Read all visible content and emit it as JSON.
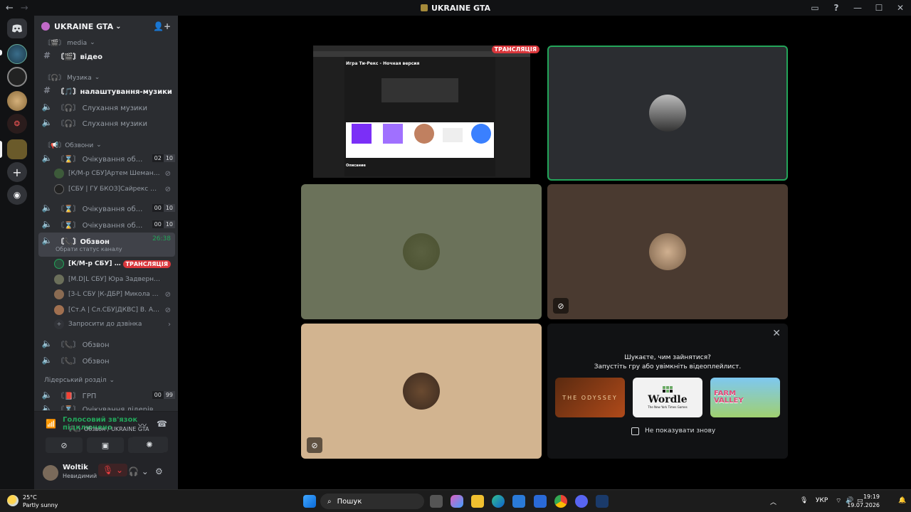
{
  "window": {
    "title": "UKRAINE GTA",
    "back": "←",
    "forward": "→",
    "inbox_icon": "inbox-icon",
    "help": "?",
    "minimize": "—",
    "maximize": "☐",
    "close": "✕"
  },
  "server": {
    "name": "UKRAINE GTA",
    "chevron": "⌄",
    "invite_icon": "+"
  },
  "channels": {
    "cat_media": "〘🎬〙 media",
    "video": "〘🎬〙відео",
    "cat_music": "〘🎧〙 Музика",
    "music_settings": "〘🎵〙налаштування-музики",
    "listen1": "〘🎧〙 Слухання музики",
    "listen2": "〘🎧〙 Слухання музики",
    "cat_calls": "〘📢〙Обзвони",
    "waiting1": "〘⌛〙 Очікування об...",
    "waiting1_counts": [
      "02",
      "10"
    ],
    "waiting1_users": [
      {
        "name": "[К/М-р СБУ]Артем Шеманс...",
        "avatar_color": "#3d5a3a"
      },
      {
        "name": "[СБУ | ГУ БКОЗ]Сайрекс По...",
        "avatar_color": "#222"
      }
    ],
    "waiting2": "〘⌛〙 Очікування об...",
    "waiting2_counts": [
      "00",
      "10"
    ],
    "waiting3": "〘⌛〙 Очікування об...",
    "waiting3_counts": [
      "00",
      "10"
    ],
    "active_call": "〘📞〙Обзвон",
    "active_timer": "26:38",
    "active_status": "Обрати статус каналу",
    "call_users": [
      {
        "name": "[К/М-р СБУ] Са...",
        "avatar_color": "#2c4a3c",
        "live": "ТРАНСЛЯЦІЯ"
      },
      {
        "name": "[M.D|L СБУ] Юра Задверняк",
        "avatar_color": "#6b6f5a"
      },
      {
        "name": "[З-L СБУ |К-ДБР] Микола М...",
        "avatar_color": "#8a6b52"
      },
      {
        "name": "[Ст.А | Сл.СБУ|ДКВС] В. Атс...",
        "avatar_color": "#a07050"
      }
    ],
    "invite_to_call": "Запросити до дзвінка",
    "call2": "〘📞〙 Обзвон",
    "call3": "〘📞〙 Обзвон",
    "cat_leaders": "Лідерський розділ",
    "grp": "〘📕〙 ГРП",
    "grp_counts": [
      "00",
      "99"
    ],
    "partial": "〘⌛〙 Очікування лідерів"
  },
  "voice": {
    "status": "Голосовий зв'язок підключено",
    "channel": "〘📞〙Обзвон / UKRAINE GTA"
  },
  "user": {
    "name": "Woltik",
    "status": "Невидимий"
  },
  "stream": {
    "badge": "ТРАНСЛЯЦІЯ",
    "page_title": "Игра Ти-Рекс - Ночная версия",
    "section": "Описание"
  },
  "activity": {
    "line1": "Шукаєте, чим зайнятися?",
    "line2": "Запустіть гру або увімкніть відеоплейлист.",
    "games": [
      "THE ODYSSEY",
      "Wordle",
      "FARM VALLEY"
    ],
    "wordle_sub": "The New York Times Games",
    "dont_show": "Не показувати знову"
  },
  "taskbar": {
    "temp": "25°C",
    "weather": "Partly sunny",
    "search": "Пошук",
    "lang": "УКР",
    "time": "19:19",
    "date": "19.07.2026"
  }
}
